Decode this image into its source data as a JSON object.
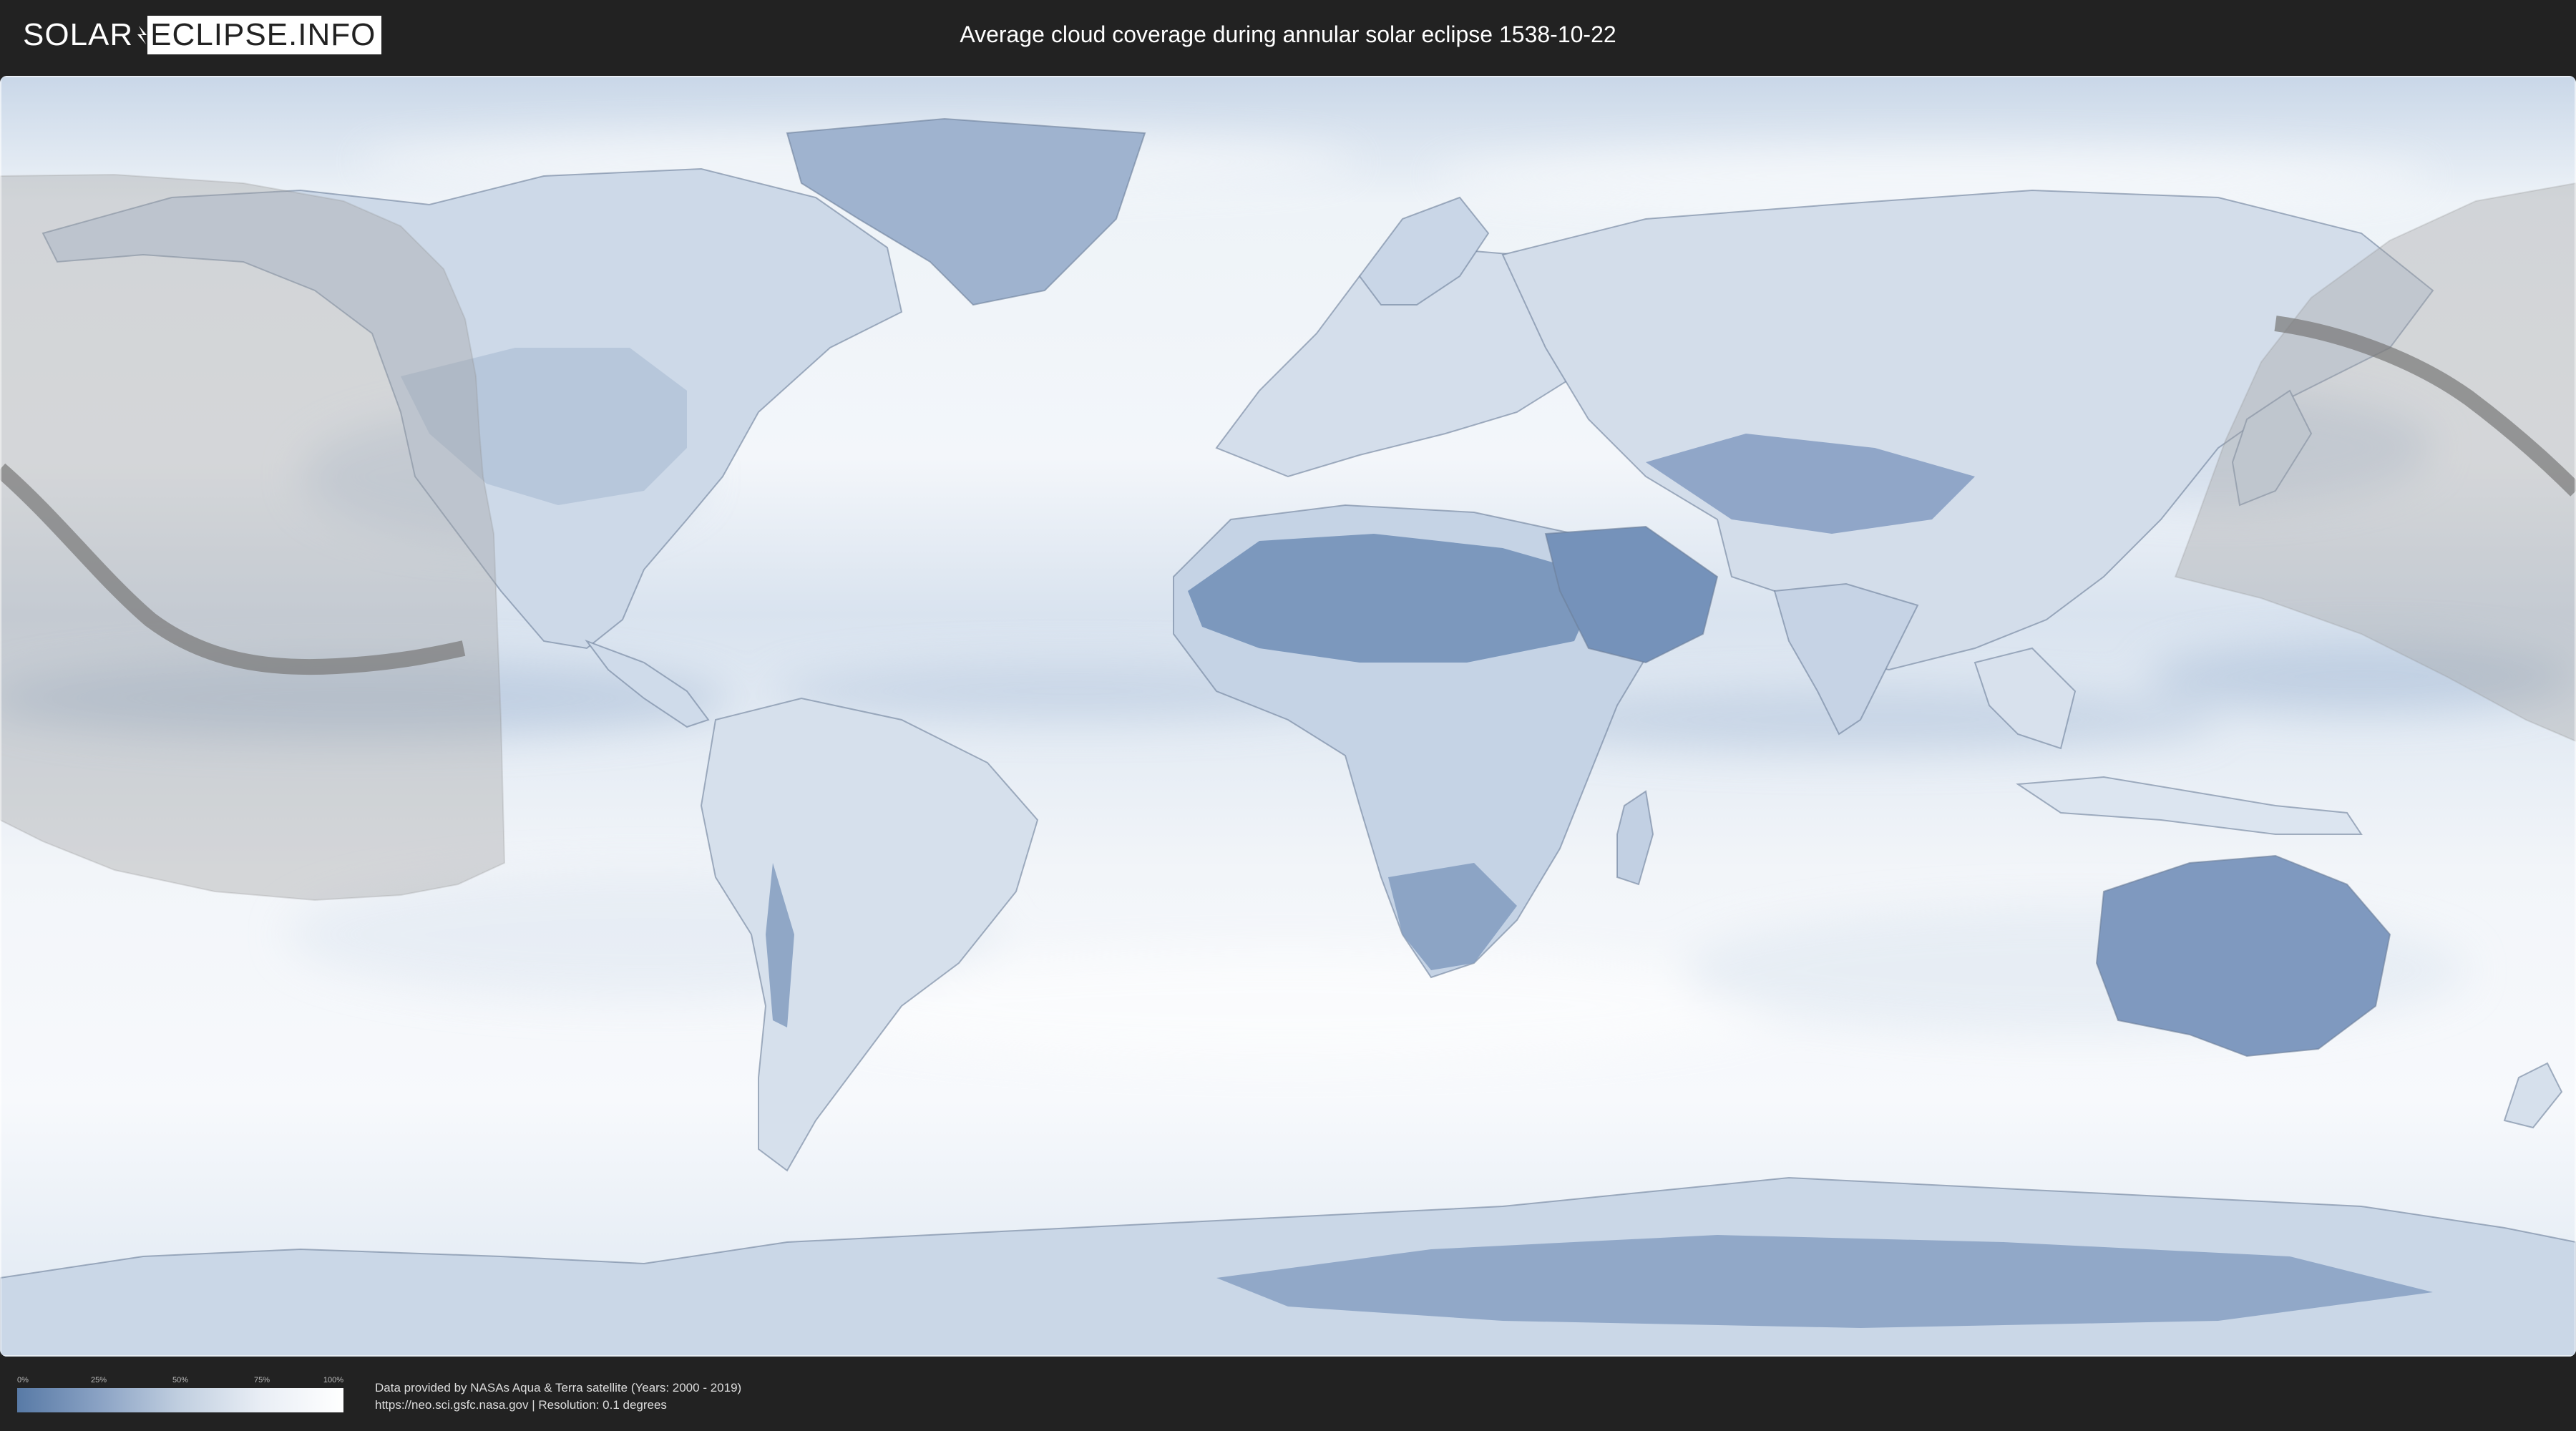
{
  "header": {
    "logo_left": "SOLAR",
    "logo_right": "ECLIPSE.INFO",
    "title": "Average cloud coverage during annular solar eclipse 1538-10-22"
  },
  "map": {
    "projection": "equirectangular",
    "layer": "average cloud coverage",
    "colors": {
      "clear": "#587aa6",
      "cloudy": "#ffffff",
      "eclipse_shadow": "#9b9b9b",
      "central_path": "#7a7a7a",
      "borders": "#6d7f99"
    }
  },
  "legend": {
    "ticks": [
      "0%",
      "25%",
      "50%",
      "75%",
      "100%"
    ],
    "gradient": [
      "#587aa6",
      "#8aa2c4",
      "#c1cfe0",
      "#e9eef5",
      "#ffffff"
    ]
  },
  "footer": {
    "credit_line1": "Data provided by NASAs Aqua & Terra satellite (Years: 2000 - 2019)",
    "credit_line2": "https://neo.sci.gsfc.nasa.gov | Resolution: 0.1 degrees"
  }
}
